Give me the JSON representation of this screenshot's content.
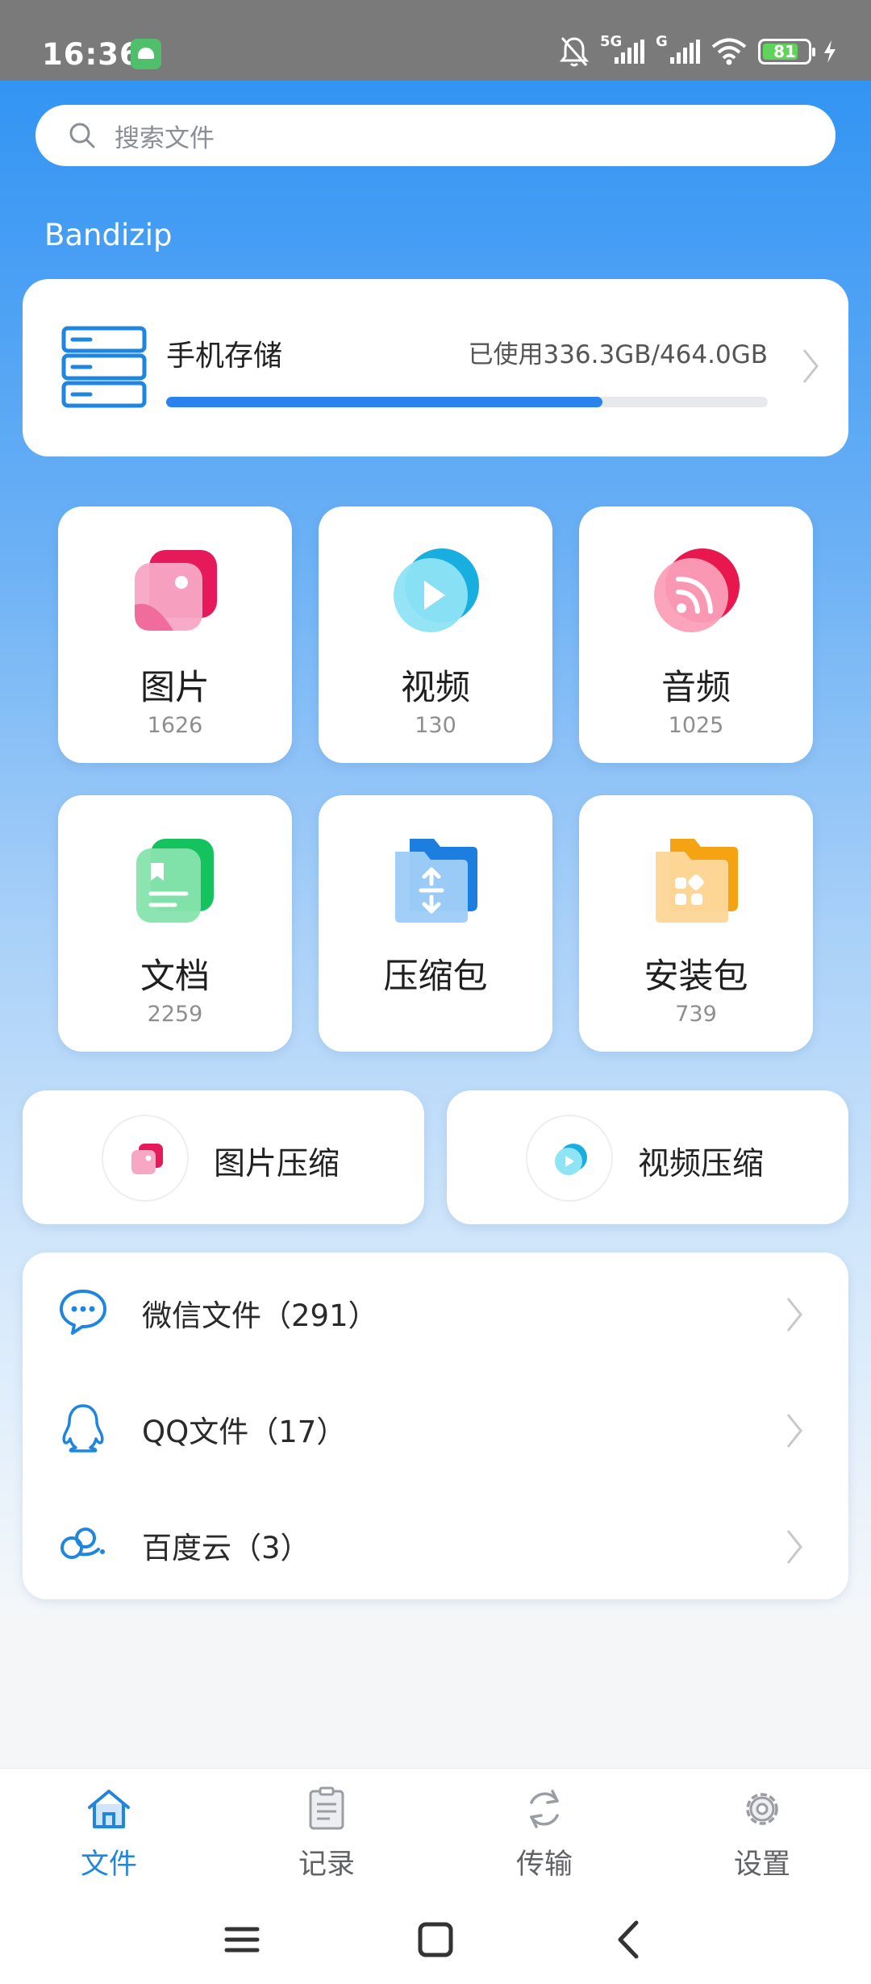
{
  "status_bar": {
    "time": "16:36",
    "network_1": "5G",
    "network_2": "G",
    "battery": "81"
  },
  "search": {
    "placeholder": "搜索文件"
  },
  "app_title": "Bandizip",
  "storage": {
    "title": "手机存储",
    "used_text": "已使用336.3GB/464.0GB",
    "used_fraction": 0.725
  },
  "categories": [
    {
      "name": "图片",
      "count": "1626",
      "icon": "image-icon",
      "color": "#f0568a"
    },
    {
      "name": "视频",
      "count": "130",
      "icon": "video-icon",
      "color": "#2fc1e8"
    },
    {
      "name": "音频",
      "count": "1025",
      "icon": "audio-icon",
      "color": "#f0406e"
    },
    {
      "name": "文档",
      "count": "2259",
      "icon": "document-icon",
      "color": "#22c76b"
    },
    {
      "name": "压缩包",
      "count": "",
      "icon": "archive-folder-icon",
      "color": "#2a86e6"
    },
    {
      "name": "安装包",
      "count": "739",
      "icon": "app-package-icon",
      "color": "#f5a623"
    }
  ],
  "quick_actions": [
    {
      "label": "图片压缩",
      "icon": "image-compress-icon"
    },
    {
      "label": "视频压缩",
      "icon": "video-compress-icon"
    }
  ],
  "sources": [
    {
      "label": "微信文件（291）",
      "icon": "wechat-icon"
    },
    {
      "label": "QQ文件（17）",
      "icon": "qq-icon"
    },
    {
      "label": "百度云（3）",
      "icon": "baidu-cloud-icon"
    }
  ],
  "bottom_nav": [
    {
      "label": "文件",
      "icon": "home-icon",
      "active": true
    },
    {
      "label": "记录",
      "icon": "clipboard-icon",
      "active": false
    },
    {
      "label": "传输",
      "icon": "sync-icon",
      "active": false
    },
    {
      "label": "设置",
      "icon": "settings-icon",
      "active": false
    }
  ],
  "colors": {
    "accent": "#1f86e0",
    "hero_top": "#3294f3",
    "progress": "#2a83ec"
  }
}
